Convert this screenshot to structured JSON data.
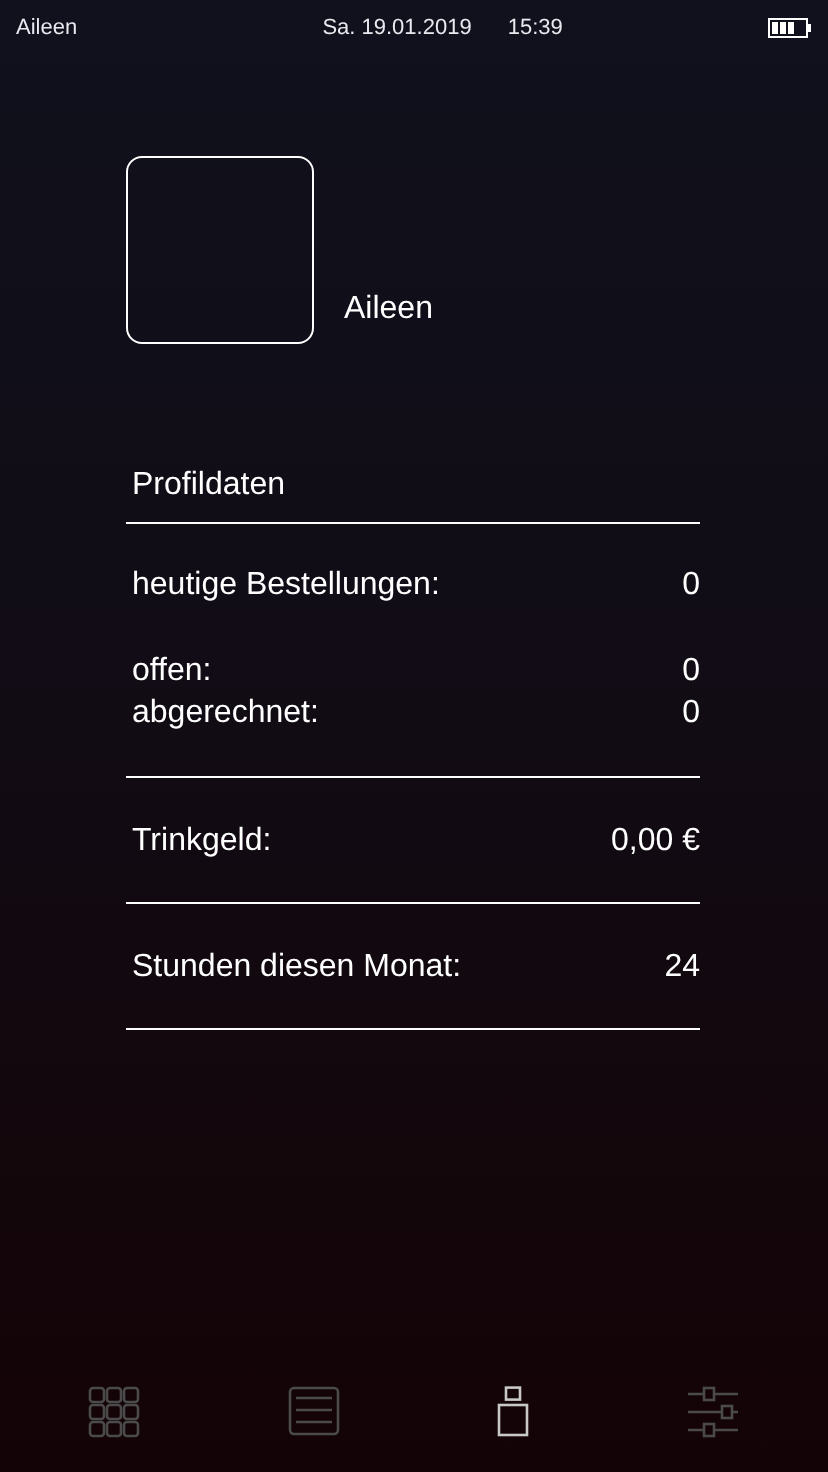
{
  "status_bar": {
    "user": "Aileen",
    "date": "Sa. 19.01.2019",
    "time": "15:39"
  },
  "profile": {
    "name": "Aileen",
    "section_title": "Profildaten",
    "sections": [
      {
        "blocks": [
          [
            {
              "label": "heutige Bestellungen:",
              "value": "0"
            }
          ],
          [
            {
              "label": "offen:",
              "value": "0"
            },
            {
              "label": "abgerechnet:",
              "value": "0"
            }
          ]
        ]
      },
      {
        "blocks": [
          [
            {
              "label": "Trinkgeld:",
              "value": "0,00 €"
            }
          ]
        ]
      },
      {
        "blocks": [
          [
            {
              "label": "Stunden diesen Monat:",
              "value": "24"
            }
          ]
        ]
      }
    ]
  },
  "nav": [
    {
      "kind": "grid",
      "selected": false
    },
    {
      "kind": "list",
      "selected": false
    },
    {
      "kind": "person",
      "selected": true
    },
    {
      "kind": "sliders",
      "selected": false
    }
  ]
}
